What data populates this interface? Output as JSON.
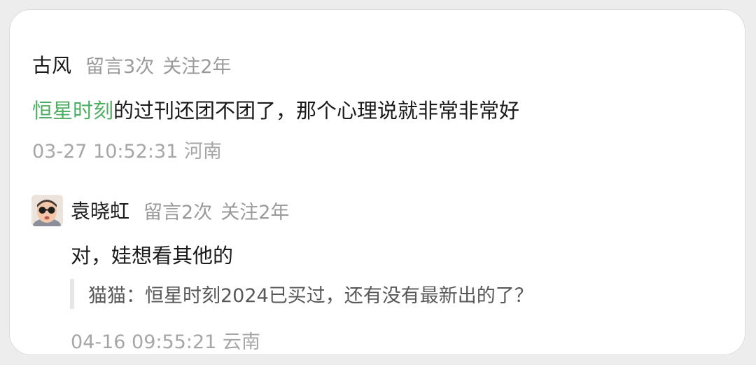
{
  "comment1": {
    "author": "古风",
    "messages": "留言3次",
    "follow": "关注2年",
    "body_link": "恒星时刻",
    "body_text": "的过刊还团不团了，那个心理说就非常非常好",
    "time": "03-27 10:52:31 河南"
  },
  "comment2": {
    "author": "袁晓虹",
    "messages": "留言2次",
    "follow": "关注2年",
    "body": "对，娃想看其他的",
    "quote": "猫猫：恒星时刻2024已买过，还有没有最新出的了？",
    "time": "04-16 09:55:21 云南"
  },
  "colors": {
    "link": "#4cae62",
    "text": "#1a1a1a",
    "meta": "#9a9a9a"
  },
  "icons": {
    "avatar": "avatar-child-sunglasses"
  }
}
